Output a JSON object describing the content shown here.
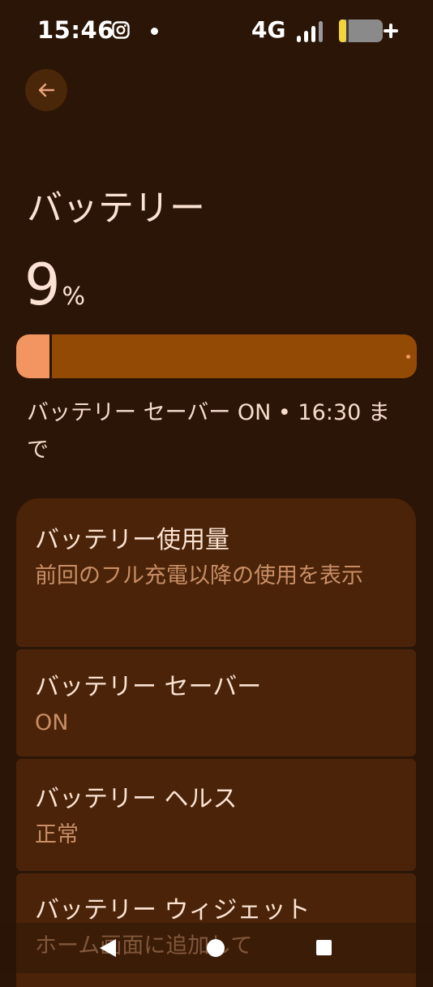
{
  "status_bar": {
    "time": "15:46",
    "network": "4G",
    "icons": [
      "instagram-icon",
      "notification-dot-icon",
      "signal-icon",
      "battery-charging-icon"
    ]
  },
  "header": {
    "back_icon": "arrow-left-icon",
    "title": "バッテリー"
  },
  "battery": {
    "percent": "9",
    "percent_unit": "%",
    "level_fraction": 0.09,
    "saver_status": "バッテリー セーバー ON • 16:30 まで"
  },
  "settings": [
    {
      "title": "バッテリー使用量",
      "subtitle": "前回のフル充電以降の使用を表示"
    },
    {
      "title": "バッテリー セーバー",
      "subtitle": "ON"
    },
    {
      "title": "バッテリー ヘルス",
      "subtitle": "正常"
    },
    {
      "title": "バッテリー ウィジェット",
      "subtitle": "ホーム画面に追加して"
    }
  ],
  "nav": {
    "icons": [
      "back-triangle-icon",
      "home-circle-icon",
      "recents-square-icon"
    ]
  },
  "colors": {
    "background": "#2a1506",
    "card": "#4a2308",
    "bar_track": "#934a04",
    "bar_fill": "#f39560",
    "subtitle": "#c98e66",
    "text": "#fbe2d2"
  }
}
